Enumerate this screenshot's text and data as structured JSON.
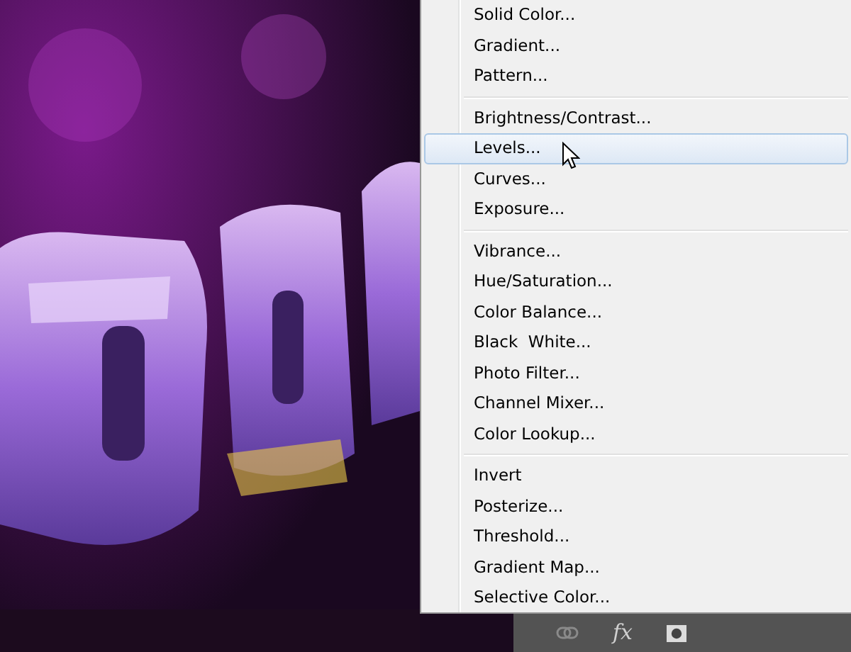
{
  "menu": {
    "groups": [
      [
        {
          "label": "Solid Color...",
          "selected": false
        },
        {
          "label": "Gradient...",
          "selected": false
        },
        {
          "label": "Pattern...",
          "selected": false
        }
      ],
      [
        {
          "label": "Brightness/Contrast...",
          "selected": false
        },
        {
          "label": "Levels...",
          "selected": true
        },
        {
          "label": "Curves...",
          "selected": false
        },
        {
          "label": "Exposure...",
          "selected": false
        }
      ],
      [
        {
          "label": "Vibrance...",
          "selected": false
        },
        {
          "label": "Hue/Saturation...",
          "selected": false
        },
        {
          "label": "Color Balance...",
          "selected": false
        },
        {
          "label": "Black  White...",
          "selected": false
        },
        {
          "label": "Photo Filter...",
          "selected": false
        },
        {
          "label": "Channel Mixer...",
          "selected": false
        },
        {
          "label": "Color Lookup...",
          "selected": false
        }
      ],
      [
        {
          "label": "Invert",
          "selected": false
        },
        {
          "label": "Posterize...",
          "selected": false
        },
        {
          "label": "Threshold...",
          "selected": false
        },
        {
          "label": "Gradient Map...",
          "selected": false
        },
        {
          "label": "Selective Color...",
          "selected": false
        }
      ]
    ]
  },
  "layers_bar": {
    "fx_label": "fx"
  }
}
